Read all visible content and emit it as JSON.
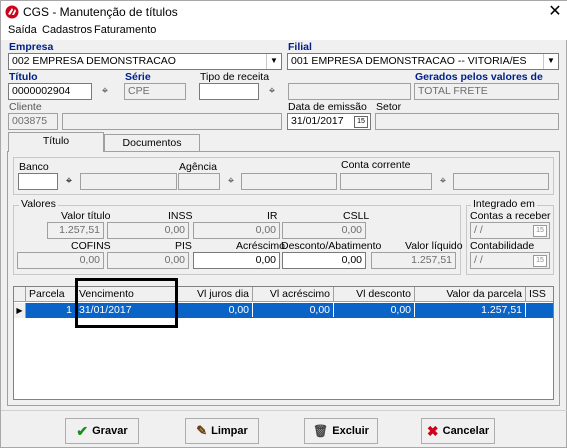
{
  "window": {
    "title": "CGS - Manutenção de títulos"
  },
  "menu": {
    "items": [
      "Saída",
      "Cadastros",
      "Faturamento"
    ]
  },
  "header": {
    "empresa_label": "Empresa",
    "empresa_value": "002 EMPRESA DEMONSTRACAO",
    "filial_label": "Filial",
    "filial_value": "001 EMPRESA DEMONSTRACAO -- VITORIA/ES",
    "titulo_label": "Título",
    "titulo_value": "0000002904",
    "serie_label": "Série",
    "serie_value": "CPE",
    "tipo_receita_label": "Tipo de receita",
    "tipo_receita_value": "",
    "gerados_label": "Gerados pelos valores de",
    "gerados_value": "TOTAL FRETE",
    "cliente_label": "Cliente",
    "cliente_value": "003875",
    "data_emissao_label": "Data de emissão",
    "data_emissao_value": "31/01/2017",
    "setor_label": "Setor",
    "setor_value": ""
  },
  "tabs": [
    {
      "label": "Título"
    },
    {
      "label": "Documentos"
    }
  ],
  "banco": {
    "banco_label": "Banco",
    "agencia_label": "Agência",
    "conta_label": "Conta corrente"
  },
  "valores": {
    "group_label": "Valores",
    "valor_titulo_label": "Valor título",
    "valor_titulo": "1.257,51",
    "inss_label": "INSS",
    "inss": "0,00",
    "ir_label": "IR",
    "ir": "0,00",
    "csll_label": "CSLL",
    "csll": "0,00",
    "cofins_label": "COFINS",
    "cofins": "0,00",
    "pis_label": "PIS",
    "pis": "0,00",
    "acrescimo_label": "Acréscimo",
    "acrescimo": "0,00",
    "desconto_label": "Desconto/Abatimento",
    "desconto": "0,00",
    "valor_liquido_label": "Valor líquido",
    "valor_liquido": "1.257,51"
  },
  "integrado": {
    "group_label": "Integrado em",
    "contas_label": "Contas a receber",
    "contas_value": " / /",
    "contabilidade_label": "Contabilidade",
    "contabilidade_value": " / /"
  },
  "grid": {
    "headers": [
      "Parcela",
      "Vencimento",
      "Vl juros dia",
      "Vl acréscimo",
      "Vl desconto",
      "Valor da parcela",
      "ISS"
    ],
    "rows": [
      {
        "parcela": "1",
        "vencimento": "31/01/2017",
        "juros": "0,00",
        "acrescimo": "0,00",
        "desconto": "0,00",
        "valor": "1.257,51"
      }
    ]
  },
  "buttons": {
    "gravar": "Gravar",
    "limpar": "Limpar",
    "excluir": "Excluir",
    "cancelar": "Cancelar"
  }
}
